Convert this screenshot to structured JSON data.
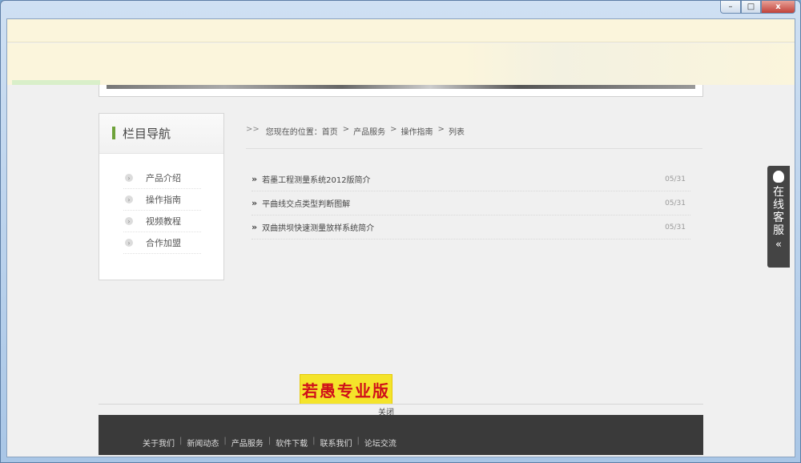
{
  "window": {
    "min_symbol": "–",
    "max_symbol": "□",
    "close_symbol": "x"
  },
  "sidebar": {
    "title": "栏目导航",
    "items": [
      {
        "label": "产品介绍"
      },
      {
        "label": "操作指南"
      },
      {
        "label": "视频教程"
      },
      {
        "label": "合作加盟"
      }
    ]
  },
  "breadcrumb": {
    "arrow": ">>",
    "prefix": "您现在的位置：",
    "home": "首页",
    "sep": ">",
    "level1": "产品服务",
    "level2": "操作指南",
    "level3": "列表"
  },
  "articles": [
    {
      "title": "若墨工程测量系统2012版简介",
      "date": "05/31"
    },
    {
      "title": "平曲线交点类型判断图解",
      "date": "05/31"
    },
    {
      "title": "双曲拱坝快速测量放样系统简介",
      "date": "05/31"
    }
  ],
  "service": {
    "text": "在线客服",
    "chevron": "«"
  },
  "ad": {
    "text": "若愚专业版",
    "close": "关闭"
  },
  "footer": {
    "links": [
      "关于我们",
      "新闻动态",
      "产品服务",
      "软件下载",
      "联系我们",
      "论坛交流"
    ],
    "separator": "|"
  }
}
